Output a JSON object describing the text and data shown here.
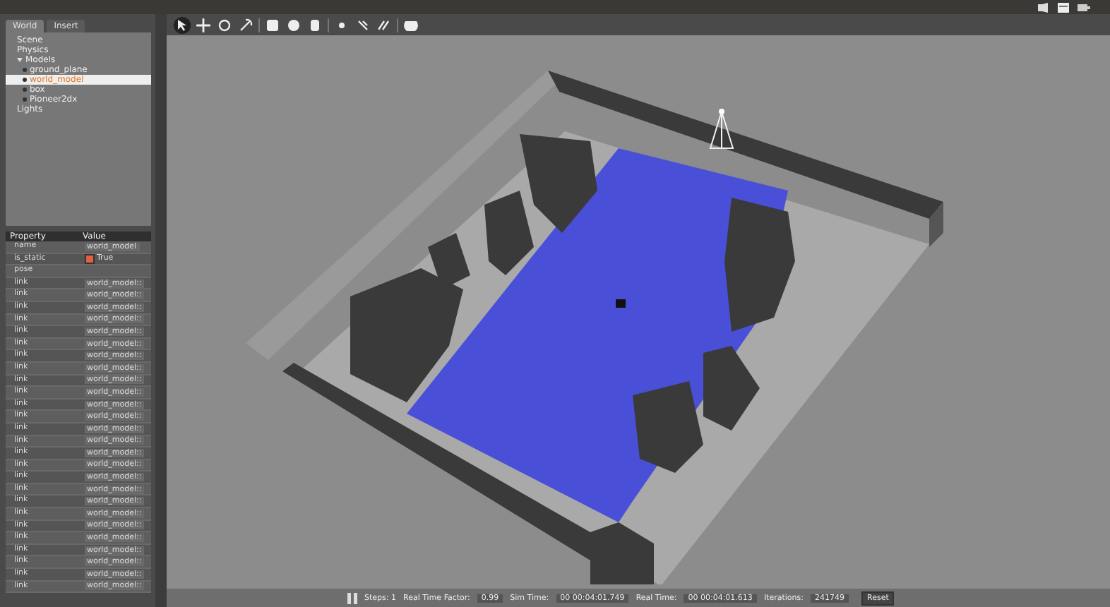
{
  "tabs": [
    {
      "label": "World",
      "selected": true
    },
    {
      "label": "Insert",
      "selected": false
    }
  ],
  "tree": [
    {
      "label": "Scene",
      "selected": false
    },
    {
      "label": "Physics",
      "selected": false
    },
    {
      "label": "Models",
      "selected": false,
      "expanded": true,
      "children": [
        {
          "label": "ground_plane",
          "selected": false
        },
        {
          "label": "world_model",
          "selected": true
        },
        {
          "label": "box",
          "selected": false
        },
        {
          "label": "Pioneer2dx",
          "selected": false
        }
      ]
    },
    {
      "label": "Lights",
      "selected": false
    }
  ],
  "properties": {
    "columns": [
      "Property",
      "Value"
    ],
    "rows": [
      {
        "kind": "text",
        "name": "name",
        "value": "world_model"
      },
      {
        "kind": "bool",
        "name": "is_static",
        "value": "True",
        "checked": true
      },
      {
        "kind": "group",
        "name": "pose",
        "value": ""
      },
      {
        "kind": "text",
        "name": "link",
        "value": "world_model::"
      },
      {
        "kind": "text",
        "name": "link",
        "value": "world_model::"
      },
      {
        "kind": "text",
        "name": "link",
        "value": "world_model::"
      },
      {
        "kind": "text",
        "name": "link",
        "value": "world_model::"
      },
      {
        "kind": "text",
        "name": "link",
        "value": "world_model::"
      },
      {
        "kind": "text",
        "name": "link",
        "value": "world_model::"
      },
      {
        "kind": "text",
        "name": "link",
        "value": "world_model::"
      },
      {
        "kind": "text",
        "name": "link",
        "value": "world_model::"
      },
      {
        "kind": "text",
        "name": "link",
        "value": "world_model::"
      },
      {
        "kind": "text",
        "name": "link",
        "value": "world_model::"
      },
      {
        "kind": "text",
        "name": "link",
        "value": "world_model::"
      },
      {
        "kind": "text",
        "name": "link",
        "value": "world_model::"
      },
      {
        "kind": "text",
        "name": "link",
        "value": "world_model::"
      },
      {
        "kind": "text",
        "name": "link",
        "value": "world_model::"
      },
      {
        "kind": "text",
        "name": "link",
        "value": "world_model::"
      },
      {
        "kind": "text",
        "name": "link",
        "value": "world_model::"
      },
      {
        "kind": "text",
        "name": "link",
        "value": "world_model::"
      },
      {
        "kind": "text",
        "name": "link",
        "value": "world_model::"
      },
      {
        "kind": "text",
        "name": "link",
        "value": "world_model::"
      },
      {
        "kind": "text",
        "name": "link",
        "value": "world_model::"
      },
      {
        "kind": "text",
        "name": "link",
        "value": "world_model::"
      },
      {
        "kind": "text",
        "name": "link",
        "value": "world_model::"
      },
      {
        "kind": "text",
        "name": "link",
        "value": "world_model::"
      },
      {
        "kind": "text",
        "name": "link",
        "value": "world_model::"
      },
      {
        "kind": "text",
        "name": "link",
        "value": "world_model::"
      },
      {
        "kind": "text",
        "name": "link",
        "value": "world_model::"
      }
    ]
  },
  "toolbar": [
    {
      "kind": "select",
      "selected": true
    },
    {
      "kind": "translate",
      "selected": false
    },
    {
      "kind": "rotate",
      "selected": false
    },
    {
      "kind": "scale",
      "selected": false
    },
    {
      "kind": "sep"
    },
    {
      "kind": "box"
    },
    {
      "kind": "sphere"
    },
    {
      "kind": "cylinder"
    },
    {
      "kind": "sep"
    },
    {
      "kind": "pointlight"
    },
    {
      "kind": "spotlight"
    },
    {
      "kind": "dirlight"
    },
    {
      "kind": "sep"
    },
    {
      "kind": "screenshot"
    }
  ],
  "status_bar": {
    "steps": "Steps: 1",
    "rtf_label": "Real Time Factor:",
    "rtf": "0.99",
    "sim_label": "Sim Time:",
    "sim": "00 00:04:01.749",
    "real_label": "Real Time:",
    "real": "00 00:04:01.613",
    "iter_label": "Iterations:",
    "iter": "241749",
    "reset": "Reset"
  }
}
